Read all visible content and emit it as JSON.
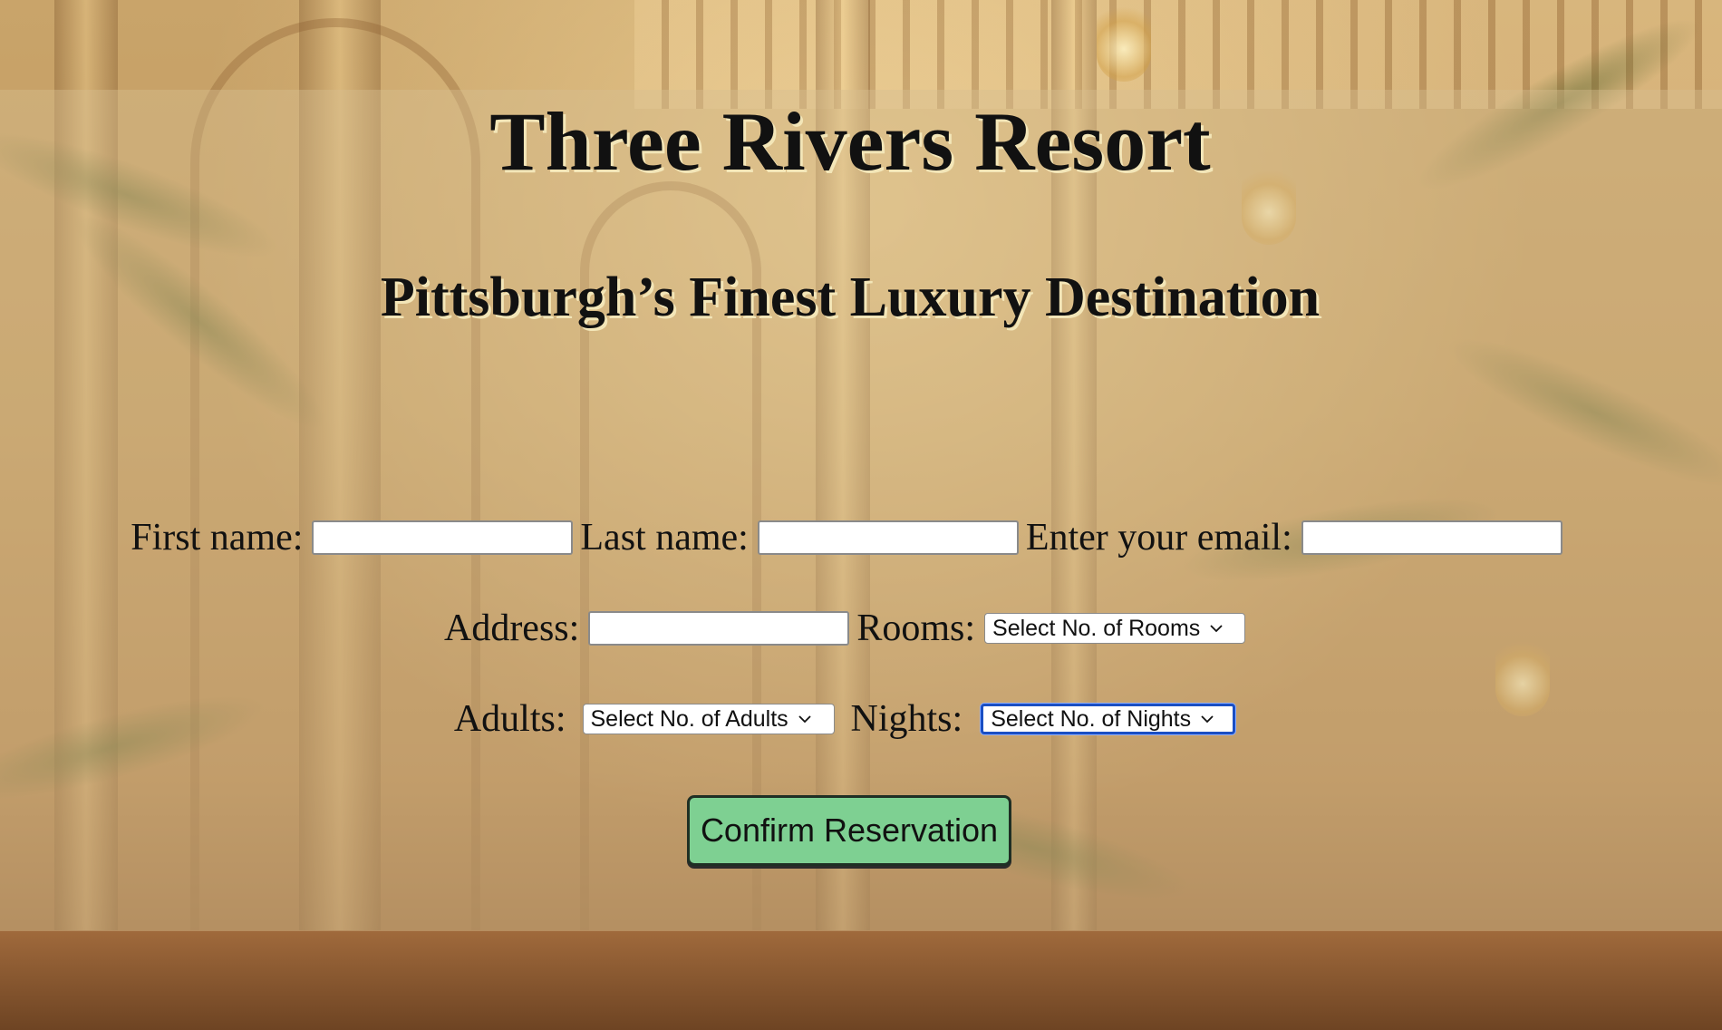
{
  "header": {
    "title": "Three Rivers Resort",
    "subtitle": "Pittsburgh’s Finest Luxury Destination"
  },
  "form": {
    "first_name": {
      "label": "First name:",
      "value": "",
      "placeholder": ""
    },
    "last_name": {
      "label": "Last name:",
      "value": "",
      "placeholder": ""
    },
    "email": {
      "label": "Enter your email:",
      "value": "",
      "placeholder": ""
    },
    "address": {
      "label": "Address:",
      "value": "",
      "placeholder": ""
    },
    "rooms": {
      "label": "Rooms:",
      "selected": "Select No. of Rooms"
    },
    "adults": {
      "label": "Adults:",
      "selected": "Select No. of Adults"
    },
    "nights": {
      "label": "Nights:",
      "selected": "Select No. of Nights",
      "focused": true
    },
    "submit_label": "Confirm Reservation"
  },
  "icons": {
    "select_arrow": "chevron-down-icon"
  },
  "colors": {
    "button_bg": "#7ed092",
    "focus_ring": "#1a4fc4",
    "heading_text": "#111111",
    "heading_shadow": "#f3e6b8"
  }
}
